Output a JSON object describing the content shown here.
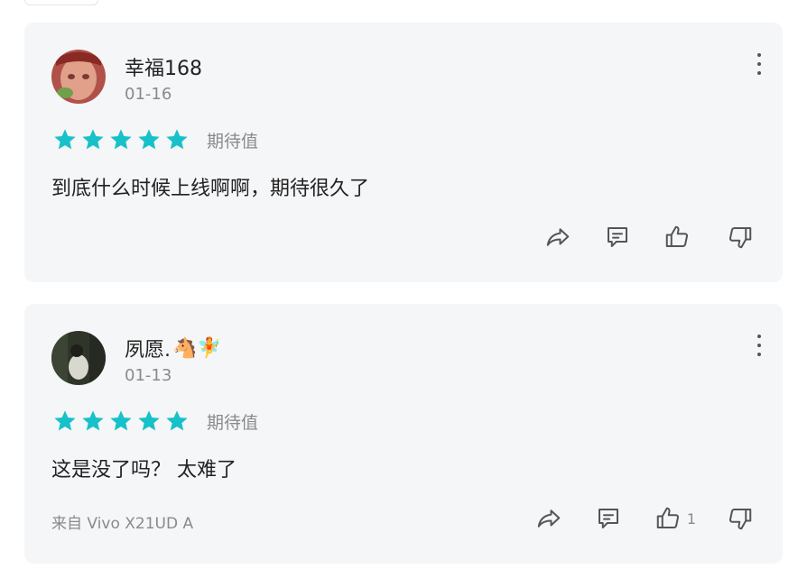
{
  "comments": [
    {
      "username": "幸福168",
      "username_emoji": "",
      "date": "01-16",
      "rating_stars": 5,
      "rating_label": "期待值",
      "content": "到底什么时候上线啊啊，期待很久了",
      "source": "",
      "like_count": ""
    },
    {
      "username": "夙愿.",
      "username_emoji": "🐴🧚",
      "date": "01-13",
      "rating_stars": 5,
      "rating_label": "期待值",
      "content": "这是没了吗？ 太难了",
      "source": "来自 Vivo X21UD A",
      "like_count": "1"
    }
  ],
  "colors": {
    "star": "#17c1c9",
    "card_bg": "#f5f6f8",
    "muted_text": "#8a8a8a",
    "icon_stroke": "#555555"
  },
  "icons": [
    "share-icon",
    "comment-icon",
    "thumbs-up-icon",
    "thumbs-down-icon",
    "more-vertical-icon",
    "star-icon"
  ]
}
